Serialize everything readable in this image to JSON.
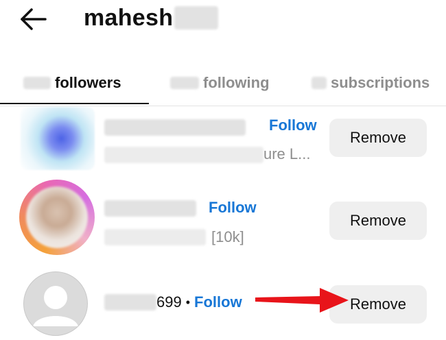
{
  "header": {
    "back_icon": "arrow-left-icon",
    "username": "mahesh"
  },
  "tabs": [
    {
      "label": "followers",
      "active": true
    },
    {
      "label": "following",
      "active": false
    },
    {
      "label": "subscriptions",
      "active": false
    }
  ],
  "rows": [
    {
      "handle_suffix": "",
      "subtitle_suffix": "ure L...",
      "follow_label": "Follow",
      "remove_label": "Remove"
    },
    {
      "handle_suffix": "",
      "subtitle_suffix": "[10k]",
      "follow_label": "Follow",
      "remove_label": "Remove"
    },
    {
      "handle_suffix": "699",
      "separator": "•",
      "follow_label": "Follow",
      "remove_label": "Remove"
    }
  ],
  "colors": {
    "link_blue": "#1877d6",
    "annotation_arrow": "#e8141a",
    "button_bg": "#efefef",
    "muted_text": "#8e8e8e"
  }
}
